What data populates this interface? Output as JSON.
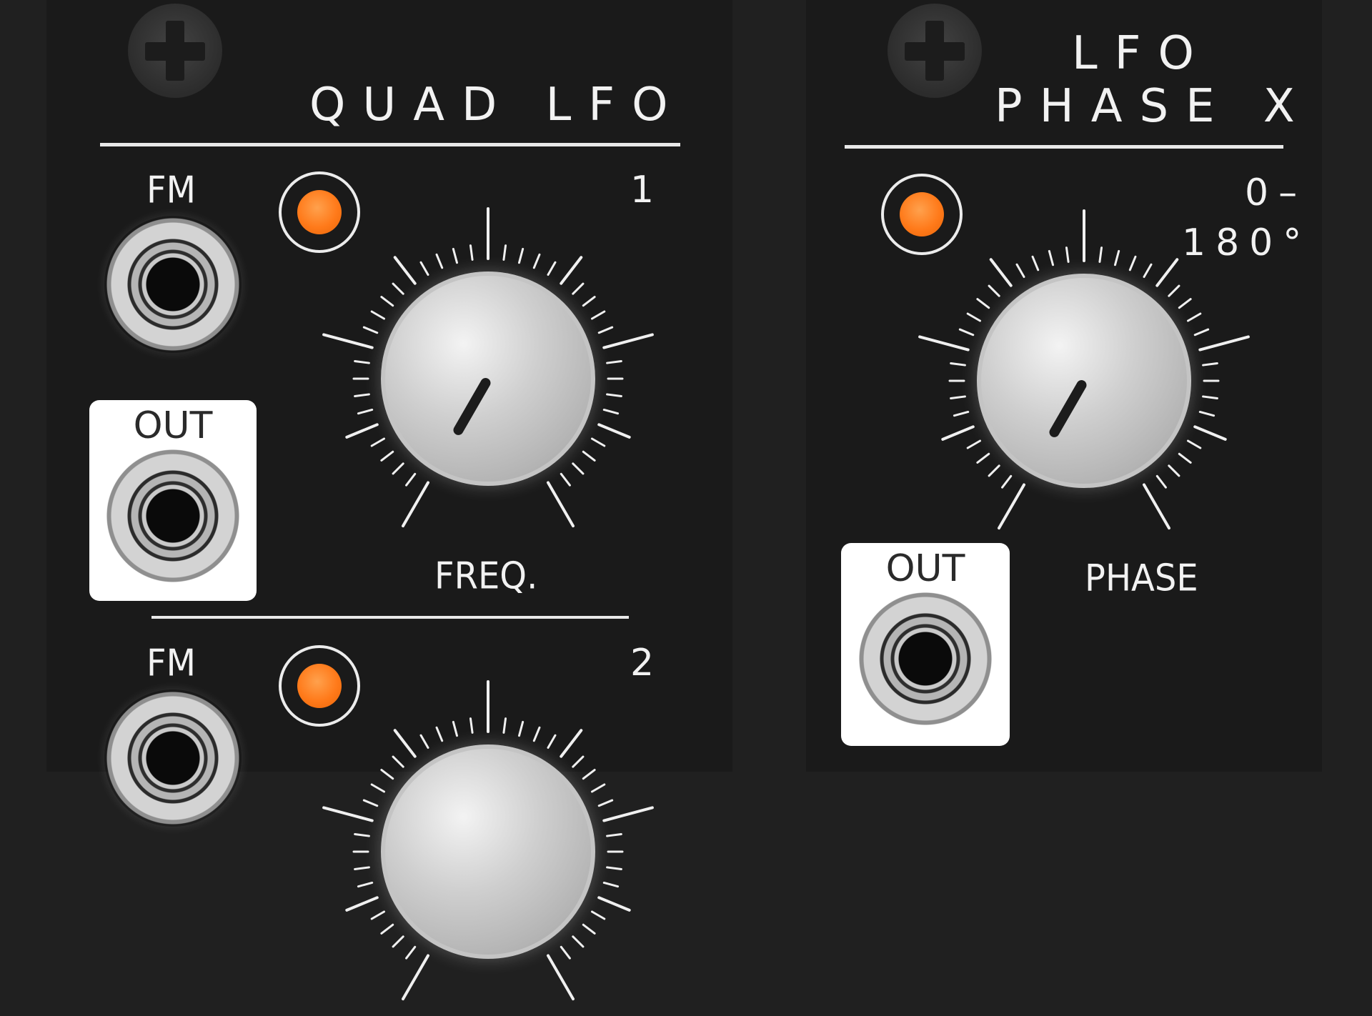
{
  "quad_lfo": {
    "title": "QUAD LFO",
    "channel_1": {
      "number": "1",
      "fm_label": "FM",
      "out_label": "OUT",
      "knob_label": "FREQ."
    },
    "channel_2": {
      "number": "2",
      "fm_label": "FM"
    }
  },
  "lfo_phase_x": {
    "title_line1": "LFO",
    "title_line2": "PHASE X",
    "range_line1": "0–",
    "range_line2": "180°",
    "out_label": "OUT",
    "knob_label": "PHASE"
  },
  "colors": {
    "panel": "#1a1a1a",
    "background": "#202020",
    "led": "#ff7a1a",
    "text": "#f2f2f2"
  },
  "icons": [
    "screw-icon",
    "led-indicator",
    "jack-socket"
  ]
}
